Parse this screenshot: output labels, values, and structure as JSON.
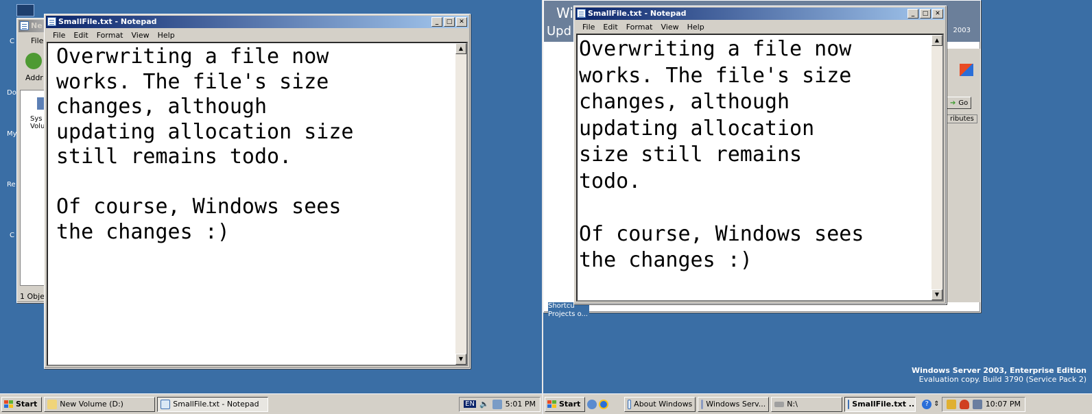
{
  "left_screen": {
    "explorer_window": {
      "title": "New Volume (D:)",
      "title_fragment": "Ne",
      "menu_fragment": "File",
      "address_label": "Addr",
      "item_label": "Sys Volu",
      "status": "1 Obje"
    },
    "desktop_fragments": [
      "C",
      "Do",
      "My",
      "Re",
      "C P"
    ],
    "notepad": {
      "title": "SmallFile.txt - Notepad",
      "menu": [
        "File",
        "Edit",
        "Format",
        "View",
        "Help"
      ],
      "content": "Overwriting a file now\nworks. The file's size\nchanges, although\nupdating allocation size\nstill remains todo.\n\nOf course, Windows sees\nthe changes :)"
    },
    "taskbar": {
      "start": "Start",
      "tasks": [
        "New Volume (D:)",
        "SmallFile.txt - Notepad"
      ],
      "lang": "EN",
      "clock": "5:01 PM"
    }
  },
  "right_screen": {
    "bg_window": {
      "title_fragment": "Wi",
      "title_line2": "Upd",
      "year_fragment": "2003",
      "go_label": "Go",
      "attributes_fragment": "ributes",
      "shortcut_label": "Shortcu",
      "shortcut_label2": "Projects o..."
    },
    "notepad": {
      "title": "SmallFile.txt - Notepad",
      "menu": [
        "File",
        "Edit",
        "Format",
        "View",
        "Help"
      ],
      "content": "Overwriting a file now\nworks. The file's size\nchanges, although\nupdating allocation\nsize still remains\ntodo.\n\nOf course, Windows sees\nthe changes :)"
    },
    "watermark": {
      "line1": "Windows Server 2003, Enterprise Edition",
      "line2": "Evaluation copy. Build 3790 (Service Pack 2)"
    },
    "taskbar": {
      "start": "Start",
      "tasks": [
        "About Windows",
        "Windows Serv...",
        "N:\\",
        "SmallFile.txt ..."
      ],
      "clock": "10:07 PM"
    }
  },
  "colors": {
    "desktop": "#3a6ea5",
    "titlebar_active": "#0a246a",
    "face": "#d4d0c8"
  }
}
